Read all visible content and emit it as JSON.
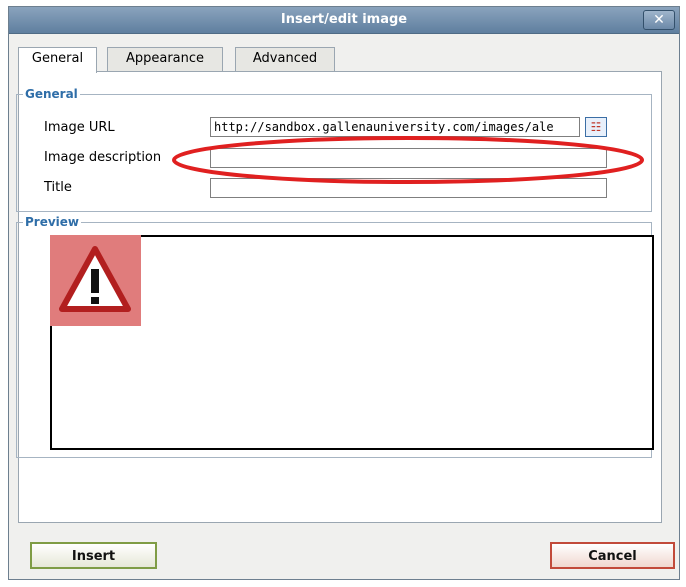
{
  "dialog": {
    "title": "Insert/edit image",
    "close_label": "✕"
  },
  "tabs": [
    {
      "label": "General",
      "active": true
    },
    {
      "label": "Appearance",
      "active": false
    },
    {
      "label": "Advanced",
      "active": false
    }
  ],
  "general": {
    "legend": "General",
    "image_url_label": "Image URL",
    "image_url_value": "http://sandbox.gallenauniversity.com/images/ale",
    "image_description_label": "Image description",
    "image_description_value": "",
    "title_label": "Title",
    "title_value": ""
  },
  "preview": {
    "legend": "Preview"
  },
  "buttons": {
    "insert_label": "Insert",
    "cancel_label": "Cancel"
  },
  "colors": {
    "accent": "#2f6ea8",
    "annotation": "#e02020",
    "warning_bg": "#e07c7c"
  },
  "icons": {
    "browse": "browse-icon",
    "warning": "warning-triangle-icon",
    "close": "close-icon"
  }
}
